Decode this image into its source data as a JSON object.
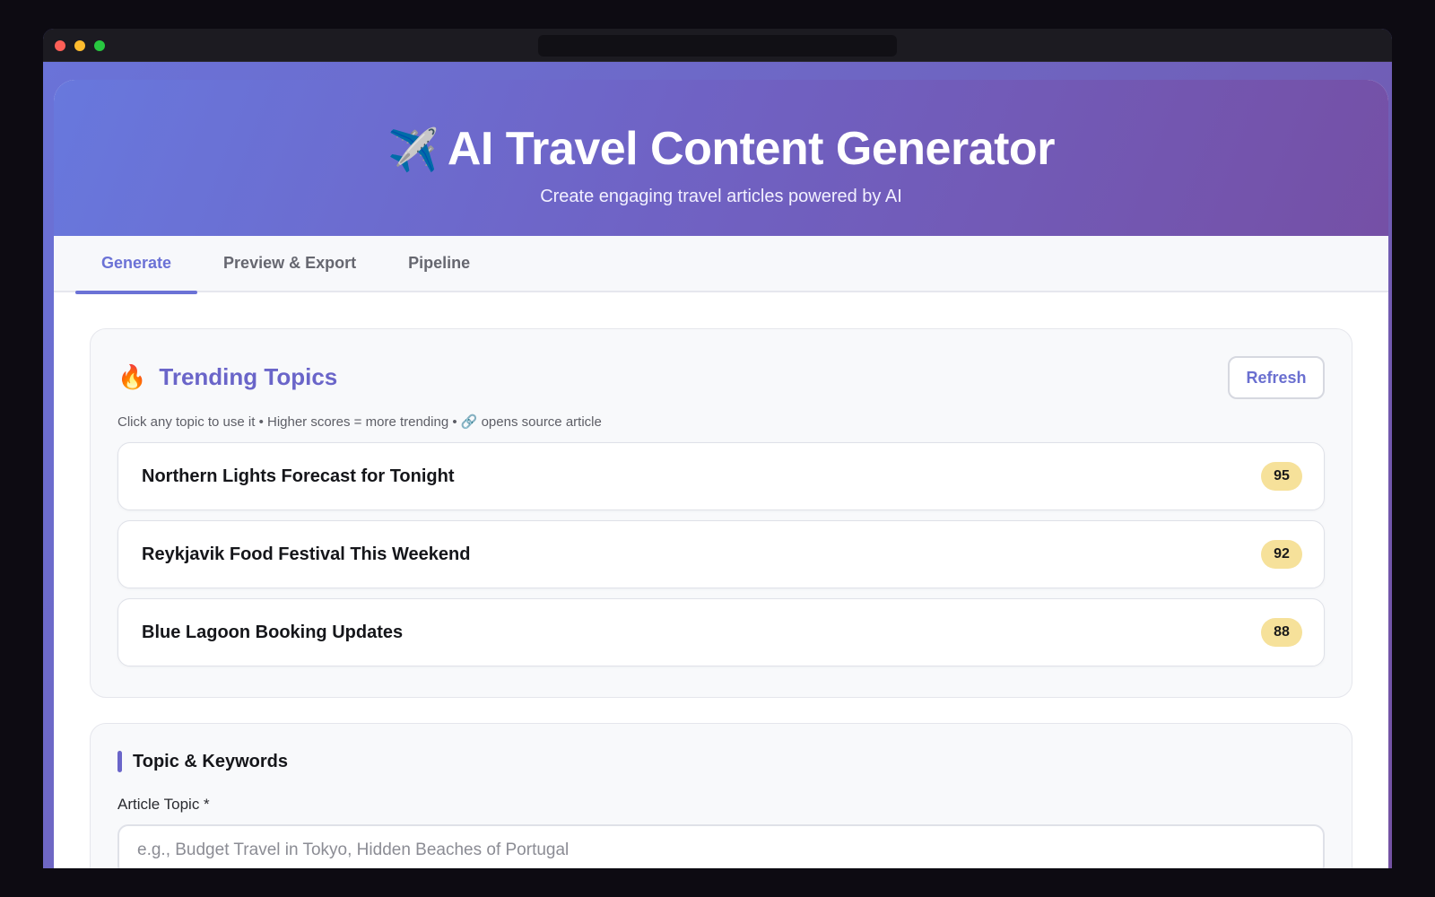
{
  "app": {
    "title": "AI Travel Content Generator",
    "title_icon": "✈️",
    "subtitle": "Create engaging travel articles powered by AI"
  },
  "tabs": [
    {
      "label": "Generate",
      "active": true
    },
    {
      "label": "Preview & Export",
      "active": false
    },
    {
      "label": "Pipeline",
      "active": false
    }
  ],
  "trending": {
    "icon": "🔥",
    "title": "Trending Topics",
    "refresh_label": "Refresh",
    "hint": "Click any topic to use it • Higher scores = more trending • 🔗 opens source article",
    "topics": [
      {
        "name": "Northern Lights Forecast for Tonight",
        "score": "95"
      },
      {
        "name": "Reykjavik Food Festival This Weekend",
        "score": "92"
      },
      {
        "name": "Blue Lagoon Booking Updates",
        "score": "88"
      }
    ]
  },
  "form": {
    "section_title": "Topic & Keywords",
    "article_topic_label": "Article Topic *",
    "article_topic_placeholder": "e.g., Budget Travel in Tokyo, Hidden Beaches of Portugal",
    "article_topic_value": ""
  },
  "colors": {
    "accent": "#6b72d6",
    "hero_start": "#6878dd",
    "hero_end": "#7550a6",
    "score_badge": "#f6e19a"
  }
}
